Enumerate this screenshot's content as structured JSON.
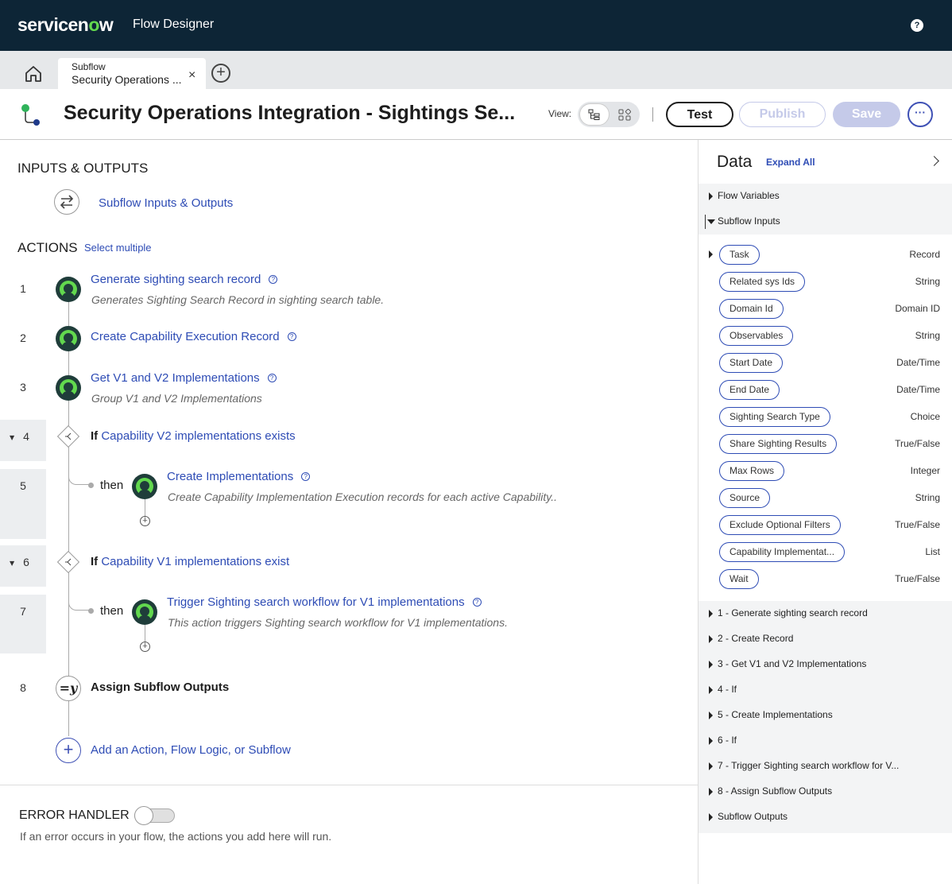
{
  "topbar": {
    "logo_text_1": "servicen",
    "logo_o": "o",
    "logo_text_2": "w",
    "app_name": "Flow Designer",
    "help_glyph": "?"
  },
  "tabs": {
    "active": {
      "type": "Subflow",
      "name": "Security Operations ...",
      "close_glyph": "×"
    },
    "add_glyph": "+"
  },
  "header": {
    "title": "Security Operations Integration - Sightings Se...",
    "view_label": "View:",
    "buttons": {
      "test": "Test",
      "publish": "Publish",
      "save": "Save",
      "more": "···"
    }
  },
  "main": {
    "inputs_outputs_title": "INPUTS & OUTPUTS",
    "inputs_outputs_link": "Subflow Inputs & Outputs",
    "actions_title": "ACTIONS",
    "select_multiple": "Select multiple",
    "actions": [
      {
        "num": "1",
        "title": "Generate sighting search record",
        "desc": "Generates Sighting Search Record in sighting search table."
      },
      {
        "num": "2",
        "title": "Create Capability Execution Record",
        "desc": ""
      },
      {
        "num": "3",
        "title": "Get V1 and V2 Implementations",
        "desc": "Group V1 and V2 Implementations"
      },
      {
        "num": "4",
        "if_keyword": "If",
        "condition": "Capability V2 implementations exists"
      },
      {
        "num": "5",
        "then": "then",
        "title": "Create Implementations",
        "desc": "Create Capability Implementation Execution records for each active Capability.."
      },
      {
        "num": "6",
        "if_keyword": "If",
        "condition": "Capability V1 implementations exist"
      },
      {
        "num": "7",
        "then": "then",
        "title": "Trigger Sighting search workflow for V1 implementations",
        "desc": "This action triggers Sighting search workflow for V1 implementations."
      },
      {
        "num": "8",
        "title": "Assign Subflow Outputs",
        "icon_text": "=y"
      }
    ],
    "add_action": "Add an Action, Flow Logic, or Subflow",
    "error_handler_title": "ERROR HANDLER",
    "error_handler_desc": "If an error occurs in your flow, the actions you add here will run.",
    "error_handler_enabled": false
  },
  "data_panel": {
    "title": "Data",
    "expand_all": "Expand All",
    "flow_variables": "Flow Variables",
    "subflow_inputs": "Subflow Inputs",
    "inputs": [
      {
        "name": "Task",
        "type": "Record"
      },
      {
        "name": "Related sys Ids",
        "type": "String"
      },
      {
        "name": "Domain Id",
        "type": "Domain ID"
      },
      {
        "name": "Observables",
        "type": "String"
      },
      {
        "name": "Start Date",
        "type": "Date/Time"
      },
      {
        "name": "End Date",
        "type": "Date/Time"
      },
      {
        "name": "Sighting Search Type",
        "type": "Choice"
      },
      {
        "name": "Share Sighting Results",
        "type": "True/False"
      },
      {
        "name": "Max Rows",
        "type": "Integer"
      },
      {
        "name": "Source",
        "type": "String"
      },
      {
        "name": "Exclude Optional Filters",
        "type": "True/False"
      },
      {
        "name": "Capability Implementat...",
        "type": "List"
      },
      {
        "name": "Wait",
        "type": "True/False"
      }
    ],
    "steps": [
      "1 - Generate sighting search record",
      "2 - Create Record",
      "3 - Get V1 and V2 Implementations",
      "4 - If",
      "5 - Create Implementations",
      "6 - If",
      "7 - Trigger Sighting search workflow for V...",
      "8 - Assign Subflow Outputs",
      "Subflow Outputs"
    ]
  },
  "colors": {
    "topbar": "#0d2536",
    "brand_green": "#62d84e",
    "link": "#2e4cb5",
    "accent": "#3f51b5"
  }
}
